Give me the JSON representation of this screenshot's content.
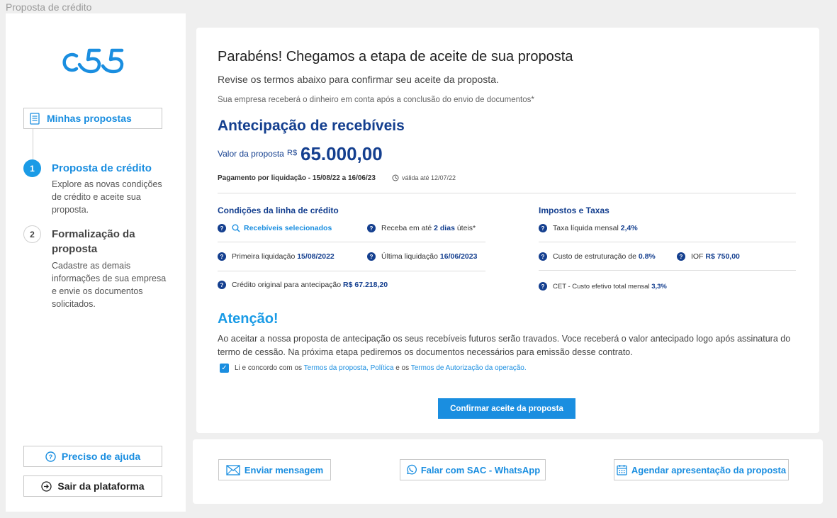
{
  "window": {
    "title": "Proposta de crédito"
  },
  "brand": {
    "logo_text": "c55",
    "color": "#1a8ee0"
  },
  "sidebar": {
    "my_proposals": "Minhas propostas",
    "steps": [
      {
        "number": "1",
        "title": "Proposta de crédito",
        "description": "Explore as novas condições de crédito e aceite sua proposta.",
        "active": true
      },
      {
        "number": "2",
        "title": "Formalização da proposta",
        "description": "Cadastre as demais informações de sua empresa e envie os documentos solicitados.",
        "active": false
      }
    ],
    "help": "Preciso de ajuda",
    "logout": "Sair da plataforma"
  },
  "main": {
    "heading": "Parabéns! Chegamos a etapa de aceite de sua proposta",
    "subheading": "Revise os termos abaixo para confirmar seu aceite da proposta.",
    "note": "Sua empresa receberá o dinheiro em conta após a conclusão do envio de documentos*",
    "product": "Antecipação de recebíveis",
    "amount_label": "Valor da proposta",
    "currency": "R$",
    "amount": "65.000,00",
    "payment": "Pagamento por liquidação - 15/08/22 a 16/06/23",
    "validity": "válida até 12/07/22",
    "conditions": {
      "title": "Condições da linha de crédito",
      "selected_receivables": "Recebíveis selecionados",
      "receive_prefix": "Receba em até",
      "receive_value": "2 dias",
      "receive_suffix": "úteis*",
      "first_label": "Primeira liquidação",
      "first_value": "15/08/2022",
      "last_label": "Última liquidação",
      "last_value": "16/06/2023",
      "original_label": "Crédito original para antecipação",
      "original_value": "R$ 67.218,20"
    },
    "taxes": {
      "title": "Impostos e Taxas",
      "rate_label": "Taxa líquida mensal",
      "rate_value": "2,4%",
      "struct_label": "Custo de estruturação de",
      "struct_value": "0.8%",
      "iof_label": "IOF",
      "iof_value": "R$ 750,00",
      "cet_label": "CET - Custo efetivo total mensal",
      "cet_value": "3,3%"
    },
    "attention": {
      "title": "Atenção!",
      "text": "Ao aceitar a nossa proposta de antecipação os seus recebíveis futuros serão travados. Voce receberá o valor antecipado logo após assinatura do termo de cessão. Na próxima etapa pediremos os documentos necessários para emissão desse contrato."
    },
    "terms": {
      "checked": true,
      "prefix": "Li e concordo com os",
      "link1": "Termos da proposta,",
      "link2": "Política",
      "middle": "e os",
      "link3": "Termos de Autorização da operação."
    },
    "confirm": "Confirmar aceite da proposta"
  },
  "footer": {
    "send_message": "Enviar  mensagem",
    "whatsapp": "Falar com SAC - WhatsApp",
    "schedule": "Agendar apresentação da proposta"
  }
}
